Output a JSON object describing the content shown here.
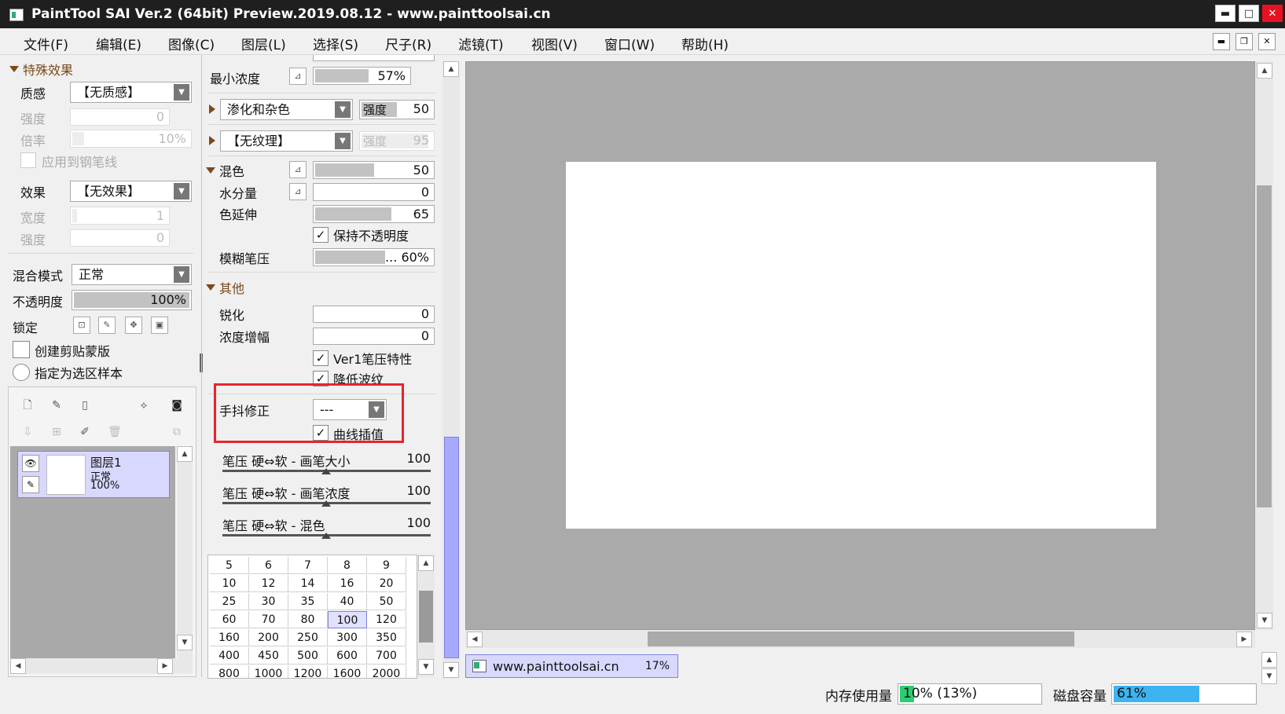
{
  "window": {
    "title": "PaintTool SAI Ver.2 (64bit) Preview.2019.08.12 - www.painttoolsai.cn",
    "minimize": "▬",
    "maximize": "□",
    "close": "✕"
  },
  "menu": [
    "文件(F)",
    "编辑(E)",
    "图像(C)",
    "图层(L)",
    "选择(S)",
    "尺子(R)",
    "滤镜(T)",
    "视图(V)",
    "窗口(W)",
    "帮助(H)"
  ],
  "left": {
    "section_title": "特殊效果",
    "texture_label": "质感",
    "texture_value": "【无质感】",
    "strength_label": "强度",
    "strength_value": "0",
    "ratio_label": "倍率",
    "ratio_value": "10%",
    "ratio_fraction": 0.1,
    "apply_pen_label": "应用到钢笔线",
    "effect_label": "效果",
    "effect_value": "【无效果】",
    "width_label": "宽度",
    "width_value": "1",
    "strength2_label": "强度",
    "strength2_value": "0",
    "blend_label": "混合模式",
    "blend_value": "正常",
    "opacity_label": "不透明度",
    "opacity_value": "100%",
    "opacity_fraction": 1.0,
    "lock_label": "锁定",
    "clip_label": "创建剪贴蒙版",
    "sel_sample_label": "指定为选区样本"
  },
  "layer": {
    "name": "图层1",
    "mode": "正常",
    "opacity": "100%"
  },
  "brush": {
    "min_density_label": "最小浓度",
    "min_density_value": "57%",
    "min_density_fraction": 0.57,
    "bleed_value": "渗化和杂色",
    "bleed_strength_label": "强度",
    "bleed_strength_value": "50",
    "bleed_fraction": 0.5,
    "texture_value": "【无纹理】",
    "texture_strength_label": "强度",
    "texture_strength_value": "95",
    "texture_fraction": 0.95,
    "mix_label": "混色",
    "mix_value": "50",
    "mix_fraction": 0.5,
    "water_label": "水分量",
    "water_value": "0",
    "water_fraction": 0.0,
    "stretch_label": "色延伸",
    "stretch_value": "65",
    "stretch_fraction": 0.65,
    "keep_opacity_label": "保持不透明度",
    "blur_label": "模糊笔压",
    "blur_value": "... 60%",
    "blur_fraction": 0.6,
    "other_title": "其他",
    "sharpen_label": "锐化",
    "sharpen_value": "0",
    "density_boost_label": "浓度增幅",
    "density_boost_value": "0",
    "ver1_label": "Ver1笔压特性",
    "reduce_ripple_label": "降低波纹",
    "stabilizer_label": "手抖修正",
    "stabilizer_value": "---",
    "curve_label": "曲线插值",
    "pressure_size_label": "笔压 硬⇔软 - 画笔大小",
    "pressure_size_value": "100",
    "pressure_density_label": "笔压 硬⇔软 - 画笔浓度",
    "pressure_density_value": "100",
    "pressure_mix_label": "笔压 硬⇔软 - 混色",
    "pressure_mix_value": "100",
    "size_grid": [
      [
        "5",
        "6",
        "7",
        "8",
        "9"
      ],
      [
        "10",
        "12",
        "14",
        "16",
        "20"
      ],
      [
        "25",
        "30",
        "35",
        "40",
        "50"
      ],
      [
        "60",
        "70",
        "80",
        "100",
        "120"
      ],
      [
        "160",
        "200",
        "250",
        "300",
        "350"
      ],
      [
        "400",
        "450",
        "500",
        "600",
        "700"
      ],
      [
        "800",
        "1000",
        "1200",
        "1600",
        "2000"
      ]
    ],
    "selected_size": "100"
  },
  "canvas": {
    "tab_title": "www.painttoolsai.cn",
    "tab_zoom": "17%"
  },
  "status": {
    "memory_label": "内存使用量",
    "memory_value": "10% (13%)",
    "memory_fraction": 0.1,
    "disk_label": "磁盘容量",
    "disk_value": "61%",
    "disk_fraction": 0.61
  },
  "colors": {
    "highlight_box": "#e8242d",
    "memory_fill": "#2ecc71",
    "disk_fill": "#3db3f0",
    "layer_selected": "#d8d8ff",
    "scroll_thumb": "#a8a8ff"
  }
}
